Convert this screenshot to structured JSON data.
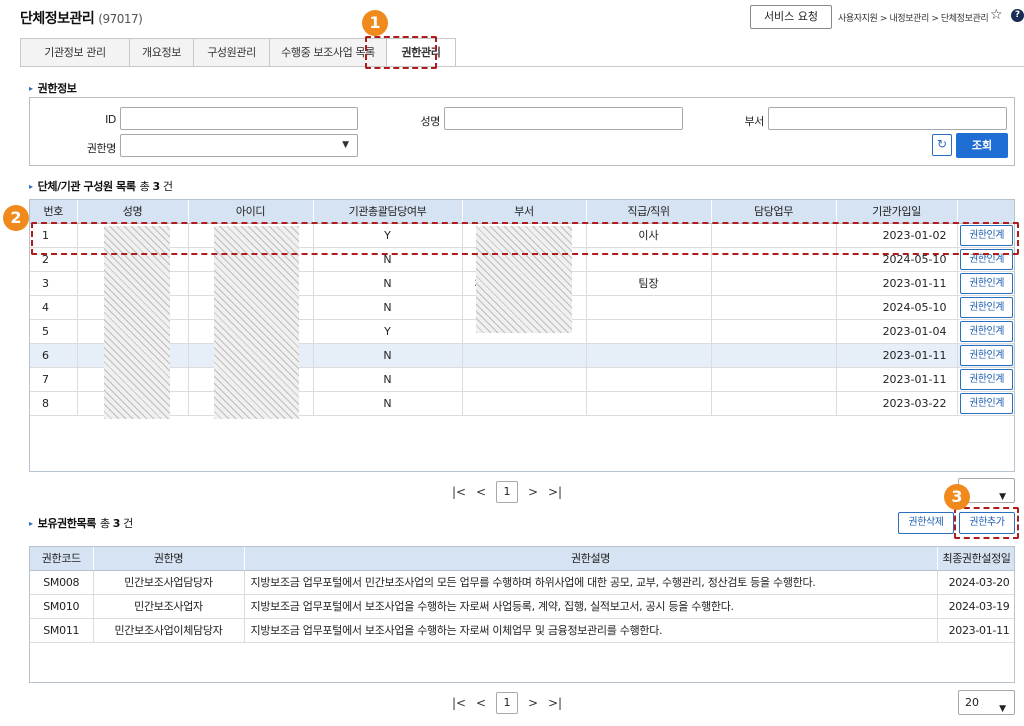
{
  "header": {
    "title": "단체정보관리",
    "org_code": "(97017)",
    "service_button": "서비스 요청",
    "breadcrumb": "사용자지원 > 내정보관리 > 단체정보관리",
    "star_icon": "star-icon",
    "help_icon": "?"
  },
  "tabs": [
    "기관정보 관리",
    "개요정보",
    "구성원관리",
    "수행중 보조사업 목록",
    "권한관리"
  ],
  "active_tab": "권한관리",
  "search": {
    "section_title": "권한정보",
    "id_label": "ID",
    "id_value": "",
    "name_label": "성명",
    "name_value": "",
    "dept_label": "부서",
    "dept_value": "",
    "role_label": "권한명",
    "role_value": "",
    "search_button": "조회",
    "reset_icon": "↻"
  },
  "members": {
    "section_title": "단체/기관 구성원 목록",
    "count_prefix": "총",
    "count": "3",
    "count_suffix": "건",
    "columns": [
      "번호",
      "성명",
      "아이디",
      "기관총괄담당여부",
      "부서",
      "직급/직위",
      "담당업무",
      "기관가입일",
      ""
    ],
    "rows": [
      {
        "no": "1",
        "admin": "Y",
        "dept": "",
        "position": "이사",
        "joined": "2023-01-02",
        "action": "권한인계"
      },
      {
        "no": "2",
        "admin": "N",
        "dept": "",
        "position": "",
        "joined": "2024-05-10",
        "action": "권한인계"
      },
      {
        "no": "3",
        "admin": "N",
        "dept": "체",
        "position": "팀장",
        "joined": "2023-01-11",
        "action": "권한인계"
      },
      {
        "no": "4",
        "admin": "N",
        "dept": "",
        "position": "",
        "joined": "2024-05-10",
        "action": "권한인계"
      },
      {
        "no": "5",
        "admin": "Y",
        "dept": "",
        "position": "",
        "joined": "2023-01-04",
        "action": "권한인계"
      },
      {
        "no": "6",
        "admin": "N",
        "dept": "",
        "position": "",
        "joined": "2023-01-11",
        "action": "권한인계"
      },
      {
        "no": "7",
        "admin": "N",
        "dept": "",
        "position": "",
        "joined": "2023-01-11",
        "action": "권한인계"
      },
      {
        "no": "8",
        "admin": "N",
        "dept": "",
        "position": "",
        "joined": "2023-03-22",
        "action": "권한인계"
      }
    ],
    "page": "1"
  },
  "permissions": {
    "section_title": "보유권한목록",
    "count_prefix": "총",
    "count": "3",
    "count_suffix": "건",
    "delete_button": "권한삭제",
    "add_button": "권한추가",
    "columns": [
      "권한코드",
      "권한명",
      "권한설명",
      "최종권한설정일"
    ],
    "rows": [
      {
        "code": "SM008",
        "name": "민간보조사업담당자",
        "desc": "지방보조금 업무포털에서 민간보조사업의 모든 업무를 수행하며 하위사업에 대한 공모, 교부, 수행관리, 정산검토 등을 수행한다.",
        "date": "2024-03-20"
      },
      {
        "code": "SM010",
        "name": "민간보조사업자",
        "desc": "지방보조금 업무포털에서 보조사업을 수행하는 자로써 사업등록, 계약, 집행, 실적보고서, 공시 등을 수행한다.",
        "date": "2024-03-19"
      },
      {
        "code": "SM011",
        "name": "민간보조사업이체담당자",
        "desc": "지방보조금 업무포털에서 보조사업을 수행하는 자로써 이체업무 및 금융정보관리를 수행한다.",
        "date": "2023-01-11"
      }
    ],
    "page": "1",
    "page_size": "20"
  },
  "pager_icons": {
    "first": "|<",
    "prev": "<",
    "next": ">",
    "last": ">|"
  },
  "annotations": {
    "badge1": "1",
    "badge2": "2",
    "badge3": "3",
    "accent": "#f08a1c",
    "highlight": "#b01c1c"
  }
}
